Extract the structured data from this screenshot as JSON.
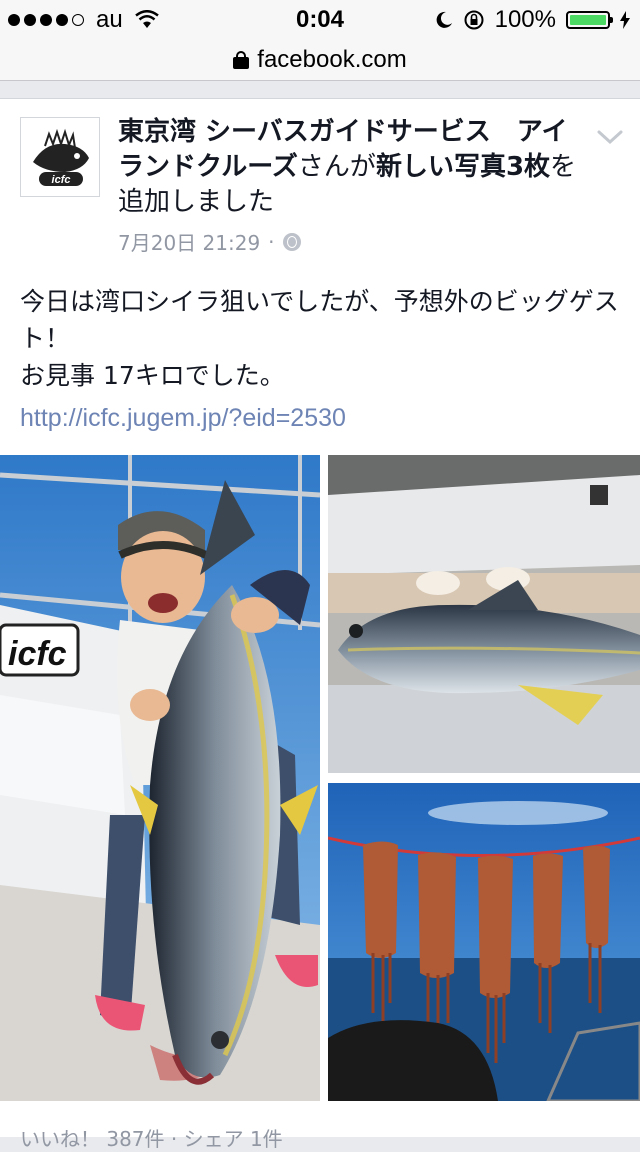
{
  "status_bar": {
    "carrier": "au",
    "time": "0:04",
    "battery_percent": "100%",
    "battery_color": "#4cd964"
  },
  "url_bar": {
    "domain": "facebook.com",
    "icon": "lock-icon"
  },
  "post": {
    "page_name": "東京湾 シーバスガイドサービス　アイランドクルーズ",
    "action_pre": "さんが",
    "action_bold": "新しい写真3枚",
    "action_post": "を追加しました",
    "timestamp": "7月20日 21:29",
    "separator": "·",
    "privacy_icon": "globe-icon",
    "body": "今日は湾口シイラ狙いでしたが、予想外のビッグゲスト！\nお見事 17キロでした。",
    "link": "http://icfc.jugem.jp/?eid=2530",
    "avatar_logo_text": "icfc",
    "photos": [
      {
        "name": "photo-angler-with-yellowtail"
      },
      {
        "name": "photo-yellowtail-on-deck"
      },
      {
        "name": "photo-squid-drying-on-line"
      }
    ],
    "footer_partial": "いいね！ 387件 · シェア 1件"
  },
  "colors": {
    "link": "#6d84b4",
    "meta": "#9197a3",
    "background": "#e9eaed"
  }
}
